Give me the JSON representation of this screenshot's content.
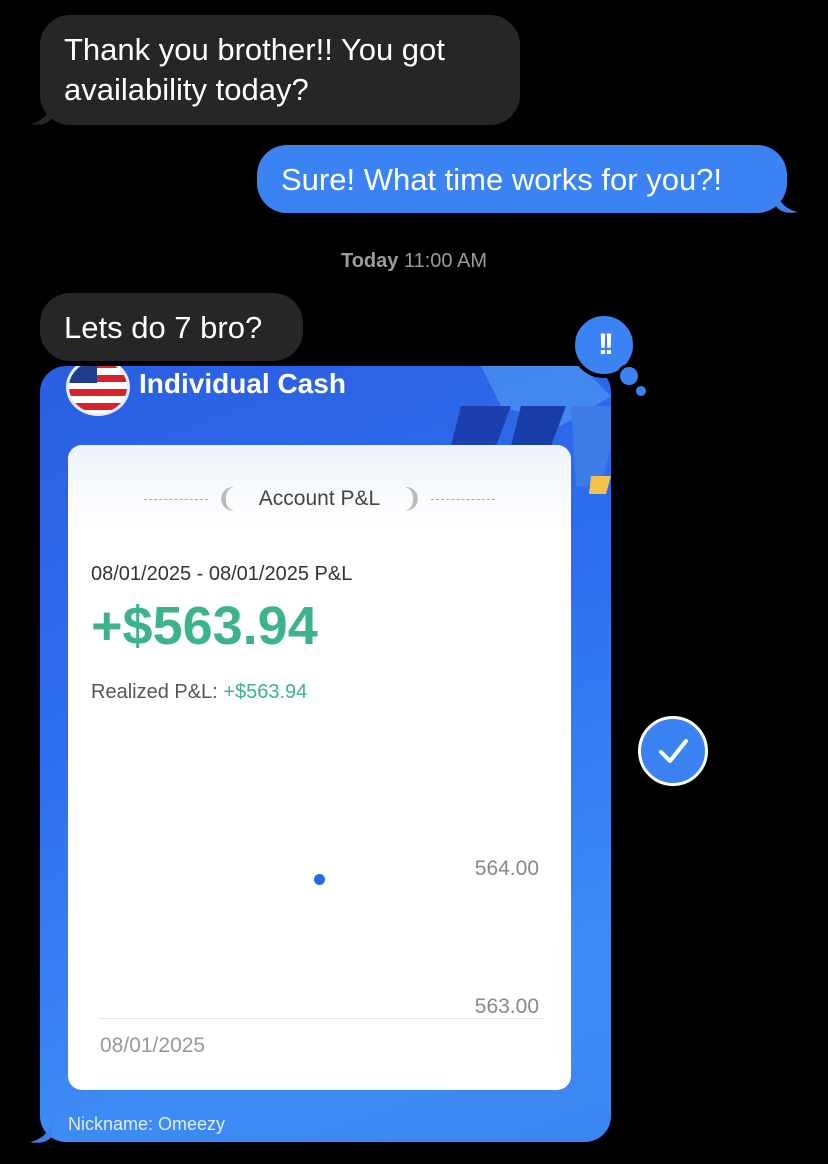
{
  "messages": [
    {
      "direction": "incoming",
      "text": "Thank you brother!! You got availability today?"
    },
    {
      "direction": "outgoing",
      "text": "Sure! What time works for you?!"
    }
  ],
  "timestamp": {
    "day": "Today",
    "time": "11:00 AM"
  },
  "message3": {
    "direction": "incoming",
    "text": "Lets do 7 bro?"
  },
  "tapback": {
    "icon": "exclamation-icon",
    "glyph": "!!"
  },
  "card": {
    "account_title": "Individual Cash",
    "pl_title": "Account P&L",
    "date_range": "08/01/2025 - 08/01/2025 P&L",
    "total": "+$563.94",
    "realized_label": "Realized P&L:",
    "realized_value": "+$563.94",
    "nickname": "Nickname: Omeezy"
  },
  "chart_data": {
    "type": "scatter",
    "x": [
      "08/01/2025"
    ],
    "y": [
      563.94
    ],
    "yticks": [
      "564.00",
      "563.00"
    ],
    "xticks": [
      "08/01/2025"
    ],
    "ylim": [
      563.0,
      564.0
    ]
  },
  "select_check": {
    "icon": "checkmark-icon"
  },
  "colors": {
    "accent": "#3b82f2",
    "incoming_bubble": "#262628",
    "profit_green": "#3db38b"
  }
}
